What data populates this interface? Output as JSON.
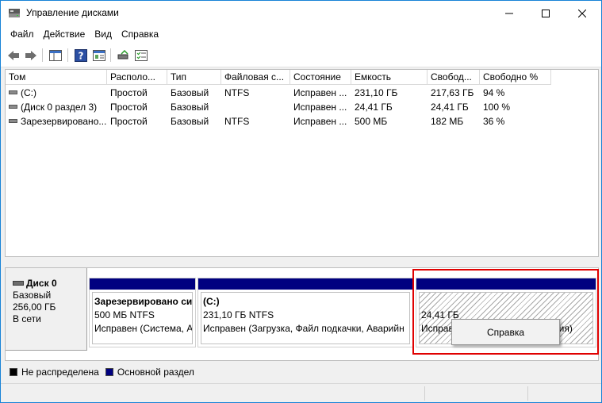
{
  "window": {
    "title": "Управление дисками"
  },
  "menu": [
    "Файл",
    "Действие",
    "Вид",
    "Справка"
  ],
  "list": {
    "columns": [
      "Том",
      "Располо...",
      "Тип",
      "Файловая с...",
      "Состояние",
      "Емкость",
      "Свобод...",
      "Свободно %"
    ],
    "rows": [
      [
        "(C:)",
        "Простой",
        "Базовый",
        "NTFS",
        "Исправен ...",
        "231,10 ГБ",
        "217,63 ГБ",
        "94 %"
      ],
      [
        "(Диск 0 раздел 3)",
        "Простой",
        "Базовый",
        "",
        "Исправен ...",
        "24,41 ГБ",
        "24,41 ГБ",
        "100 %"
      ],
      [
        "Зарезервировано...",
        "Простой",
        "Базовый",
        "NTFS",
        "Исправен ...",
        "500 МБ",
        "182 МБ",
        "36 %"
      ]
    ]
  },
  "disk": {
    "name": "Диск 0",
    "type": "Базовый",
    "size": "256,00 ГБ",
    "status": "В сети"
  },
  "partitions": [
    {
      "title": "Зарезервировано си",
      "line2": "500 МБ NTFS",
      "line3": "Исправен (Система, А"
    },
    {
      "title": "(C:)",
      "line2": "231,10 ГБ NTFS",
      "line3": "Исправен (Загрузка, Файл подкачки, Аварийн"
    },
    {
      "title": "",
      "line2": "24,41 ГБ",
      "line3": "Исправ"
    }
  ],
  "partition3_suffix": "ния)",
  "legend": {
    "unallocated": "Не распределена",
    "primary": "Основной раздел"
  },
  "context_menu": {
    "item": "Справка"
  },
  "colors": {
    "primary_bar": "#000080",
    "highlight": "#e00000",
    "unallocated": "#000000"
  }
}
